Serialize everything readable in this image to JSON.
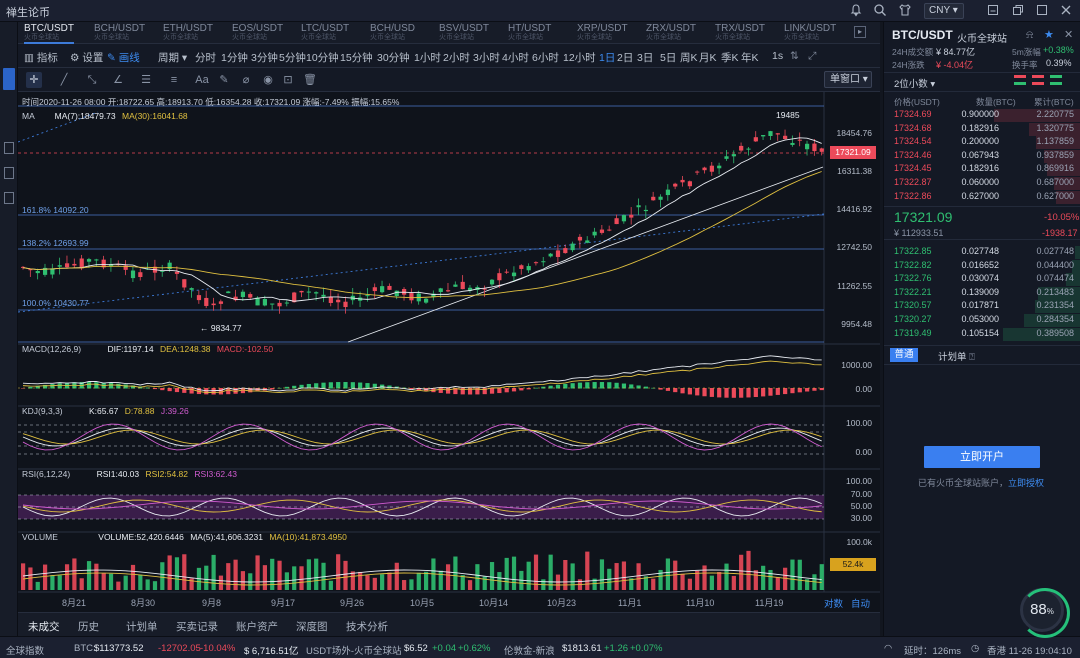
{
  "app": {
    "title": "禅生论币"
  },
  "titlebar": {
    "currency": "CNY"
  },
  "pair_tabs": [
    {
      "name": "BTC/USDT",
      "sub": "火币全球站"
    },
    {
      "name": "BCH/USDT",
      "sub": "火币全球站"
    },
    {
      "name": "ETH/USDT",
      "sub": "火币全球站"
    },
    {
      "name": "EOS/USDT",
      "sub": "火币全球站"
    },
    {
      "name": "LTC/USDT",
      "sub": "火币全球站"
    },
    {
      "name": "BCH/USD",
      "sub": "火币全球站"
    },
    {
      "name": "BSV/USDT",
      "sub": "火币全球站"
    },
    {
      "name": "HT/USDT",
      "sub": "火币全球站"
    },
    {
      "name": "XRP/USDT",
      "sub": "火币全球站"
    },
    {
      "name": "ZRX/USDT",
      "sub": "火币全球站"
    },
    {
      "name": "TRX/USDT",
      "sub": "火币全球站"
    },
    {
      "name": "LINK/USDT",
      "sub": "火币全球站"
    }
  ],
  "toolbar": {
    "indicator": "指标",
    "settings": "设置",
    "draw": "画线",
    "period": "周期",
    "periods": [
      "分时",
      "1分钟",
      "3分钟",
      "5分钟",
      "10分钟",
      "15分钟",
      "30分钟",
      "1小时",
      "2小时",
      "3小时",
      "4小时",
      "6小时",
      "12小时",
      "1日",
      "2日",
      "3日",
      "5日",
      "周K",
      "月K",
      "季K",
      "年K"
    ],
    "active_period": "1日",
    "seconds": "1s",
    "window": "单窗口"
  },
  "chart_info": {
    "ohlc": "时间2020-11-26 08:00  开:18722.65 高:18913.70 低:16354.28 收:17321.09 涨幅:-7.49% 振幅:15.65%",
    "ma_label": "MA",
    "ma7": "MA(7):18479.73",
    "ma30": "MA(30):16041.68",
    "macd_label": "MACD(12,26,9)",
    "dif": "DIF:1197.14",
    "dea": "DEA:1248.38",
    "macd": "MACD:-102.50",
    "kdj_label": "KDJ(9,3,3)",
    "k": "K:65.67",
    "d": "D:78.88",
    "j": "J:39.26",
    "rsi_label": "RSI(6,12,24)",
    "rsi1": "RSI1:40.03",
    "rsi2": "RSI2:54.82",
    "rsi3": "RSI3:62.43",
    "vol_label": "VOLUME",
    "volume": "VOLUME:52,420.6446",
    "ma5v": "MA(5):41,606.3231",
    "ma10v": "MA(10):41,873.4950",
    "high_mark": "19485",
    "low_mark": "9834.77",
    "fib": [
      {
        "label": "161.8% 14092.20"
      },
      {
        "label": "138.2% 12693.99"
      },
      {
        "label": "100.0% 10430.77"
      }
    ],
    "price_axis": [
      "18454.76",
      "16311.38",
      "14416.92",
      "12742.50",
      "11262.55",
      "9954.48"
    ],
    "price_current": "17321.09",
    "macd_axis": [
      "1000.00",
      "0.00"
    ],
    "kdj_axis": [
      "100.00",
      "0.00"
    ],
    "rsi_axis": [
      "100.00",
      "70.00",
      "50.00",
      "30.00"
    ],
    "vol_axis": [
      "100.0k",
      "52.4k"
    ],
    "dates": [
      "8月21",
      "8月30",
      "9月8",
      "9月17",
      "9月26",
      "10月5",
      "10月14",
      "10月23",
      "11月1",
      "11月10",
      "11月19"
    ],
    "log_label": "对数",
    "auto_label": "自动"
  },
  "bottom_tabs": [
    "未成交",
    "历史",
    "计划单",
    "买卖记录",
    "账户资产",
    "深度图",
    "技术分析"
  ],
  "statusbar": {
    "index": "全球指数",
    "btc_label": "BTC:",
    "btc_price": "$113773.52",
    "btc_change": "-12702.05",
    "btc_pct": "-10.04%",
    "btc_usd": "$ 6,716.51亿",
    "usdt_label": "USDT场外-火币全球站",
    "usdt_price": "$6.52",
    "usdt_change": "+0.04",
    "usdt_pct": "+0.62%",
    "gold_label": "伦敦金-新浪",
    "gold_price": "$1813.61",
    "gold_change": "+1.26",
    "gold_pct": "+0.07%",
    "latency": "延时：126ms",
    "location": "香港 11-26 19:04:10"
  },
  "right_panel": {
    "pair": "BTC/USDT",
    "exchange": "火币全球站",
    "vol24_label": "24H成交额",
    "vol24": "¥ 84.77亿",
    "change24_label": "24H涨跌",
    "change24": "¥ -4.04亿",
    "m5_label": "5m涨幅",
    "m5": "+0.38%",
    "turnover_label": "换手率",
    "turnover": "0.39%",
    "decimals": "2位小数",
    "headers": [
      "价格(USDT)",
      "数量(BTC)",
      "累计(BTC)"
    ],
    "asks": [
      {
        "price": "17324.69",
        "qty": "0.900000",
        "cum": "2.220775"
      },
      {
        "price": "17324.68",
        "qty": "0.182916",
        "cum": "1.320775"
      },
      {
        "price": "17324.54",
        "qty": "0.200000",
        "cum": "1.137859"
      },
      {
        "price": "17324.46",
        "qty": "0.067943",
        "cum": "0.937859"
      },
      {
        "price": "17324.45",
        "qty": "0.182916",
        "cum": "0.869916"
      },
      {
        "price": "17322.87",
        "qty": "0.060000",
        "cum": "0.687000"
      },
      {
        "price": "17322.86",
        "qty": "0.627000",
        "cum": "0.627000"
      }
    ],
    "last_price": "17321.09",
    "last_pct": "-10.05%",
    "last_cny": "¥ 112933.51",
    "last_change": "-1938.17",
    "bids": [
      {
        "price": "17322.85",
        "qty": "0.027748",
        "cum": "0.027748"
      },
      {
        "price": "17322.82",
        "qty": "0.016652",
        "cum": "0.044400"
      },
      {
        "price": "17322.76",
        "qty": "0.030074",
        "cum": "0.074474"
      },
      {
        "price": "17322.21",
        "qty": "0.139009",
        "cum": "0.213483"
      },
      {
        "price": "17320.57",
        "qty": "0.017871",
        "cum": "0.231354"
      },
      {
        "price": "17320.27",
        "qty": "0.053000",
        "cum": "0.284354"
      },
      {
        "price": "17319.49",
        "qty": "0.105154",
        "cum": "0.389508"
      }
    ],
    "order_tab_normal": "普通",
    "order_tab_plan": "计划单",
    "open_btn": "立即开户",
    "have_account": "已有火币全球站账户，",
    "authorize": "立即授权"
  },
  "gauge": {
    "value": "88",
    "unit": "%"
  },
  "colors": {
    "up": "#2fbf71",
    "down": "#ec4a5a",
    "accent": "#3a7ff0"
  }
}
